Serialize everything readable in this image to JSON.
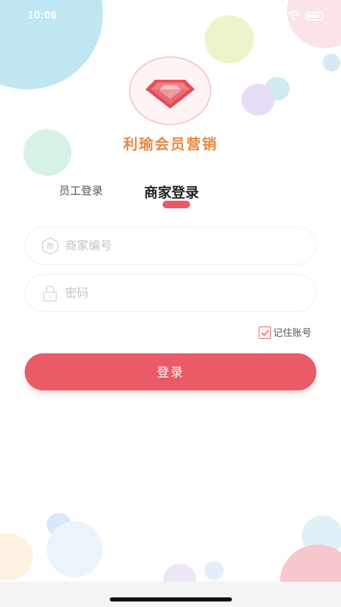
{
  "status_bar": {
    "time": "10:06"
  },
  "app": {
    "title": "利瑜会员营销"
  },
  "tabs": [
    {
      "label": "员工登录",
      "active": false
    },
    {
      "label": "商家登录",
      "active": true
    }
  ],
  "form": {
    "merchant_icon_char": "商",
    "merchant_placeholder": "商家编号",
    "merchant_value": "",
    "password_placeholder": "密码",
    "password_value": "",
    "remember_label": "记住账号",
    "remember_checked": true,
    "submit_label": "登录"
  },
  "colors": {
    "accent": "#ea5b67",
    "title": "#e8873f"
  },
  "icons": [
    "wifi-icon",
    "battery-icon",
    "diamond-logo-icon",
    "merchant-hexagon-icon",
    "lock-icon",
    "checkmark-icon"
  ]
}
